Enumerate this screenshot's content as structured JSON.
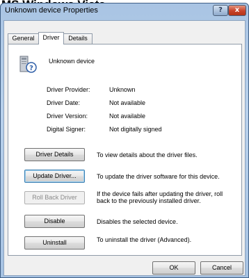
{
  "caption": "MS Windows Vista",
  "window": {
    "title": "Unknown device Properties",
    "help_label": "?",
    "close_label": "x"
  },
  "tabs": [
    {
      "label": "General",
      "active": false
    },
    {
      "label": "Driver",
      "active": true
    },
    {
      "label": "Details",
      "active": false
    }
  ],
  "device": {
    "name": "Unknown device",
    "icon": "unknown-device-icon"
  },
  "properties": [
    {
      "label": "Driver Provider:",
      "value": "Unknown"
    },
    {
      "label": "Driver Date:",
      "value": "Not available"
    },
    {
      "label": "Driver Version:",
      "value": "Not available"
    },
    {
      "label": "Digital Signer:",
      "value": "Not digitally signed"
    }
  ],
  "actions": [
    {
      "label": "Driver Details",
      "description": "To view details about the driver files.",
      "enabled": true
    },
    {
      "label": "Update Driver...",
      "description": "To update the driver software for this device.",
      "enabled": true
    },
    {
      "label": "Roll Back Driver",
      "description": "If the device fails after updating the driver, roll back to the previously installed driver.",
      "enabled": false
    },
    {
      "label": "Disable",
      "description": "Disables the selected device.",
      "enabled": true
    },
    {
      "label": "Uninstall",
      "description": "To uninstall the driver (Advanced).",
      "enabled": true
    }
  ],
  "dialog_buttons": {
    "ok": "OK",
    "cancel": "Cancel"
  }
}
